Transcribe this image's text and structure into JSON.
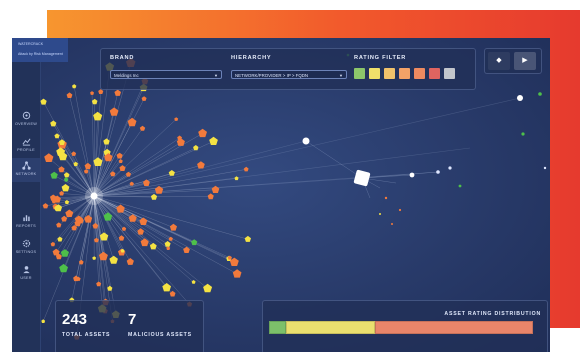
{
  "sidebar": {
    "top_line1": "WATERCRACK",
    "top_line2": "Attack by Risk Management",
    "items": [
      {
        "label": "OVERVIEW",
        "icon": "overview-icon"
      },
      {
        "label": "PROFILE",
        "icon": "profile-icon"
      },
      {
        "label": "NETWORK",
        "icon": "network-icon"
      },
      {
        "label": "REPORTS",
        "icon": "reports-icon"
      },
      {
        "label": "SETTINGS",
        "icon": "settings-icon"
      },
      {
        "label": "USER",
        "icon": "user-icon"
      }
    ]
  },
  "filters": {
    "brand_title": "BRAND",
    "brand_value": "Meldings Inc",
    "hierarchy_title": "HIERARCHY",
    "hierarchy_value": "NETWORK/PROVIDER > IP > FQDN",
    "rating_title": "RATING FILTER",
    "rating_colors": [
      "#8cc66a",
      "#f0e06a",
      "#f1c26b",
      "#f3a267",
      "#ee8a60",
      "#e06460",
      "#c3c6cc"
    ]
  },
  "controls": {
    "diamond_icon": "diamond-icon",
    "play_icon": "play-icon"
  },
  "stats": {
    "total_value": "243",
    "total_label": "TOTAL ASSETS",
    "malicious_value": "7",
    "malicious_label": "MALICIOUS ASSETS"
  },
  "distribution": {
    "title": "ASSET RATING DISTRIBUTION",
    "segments": [
      {
        "share": 0.065,
        "color": "#7cc06a"
      },
      {
        "share": 0.338,
        "color": "#eadf6f"
      },
      {
        "share": 0.597,
        "color": "#e9856a"
      }
    ]
  },
  "colors": {
    "band_start": "#f7962f",
    "band_end": "#e63a2e",
    "app_bg": "#283a69",
    "node_orange": "#f27a3c",
    "node_yellow": "#f4e243",
    "node_green": "#4ec04a"
  }
}
